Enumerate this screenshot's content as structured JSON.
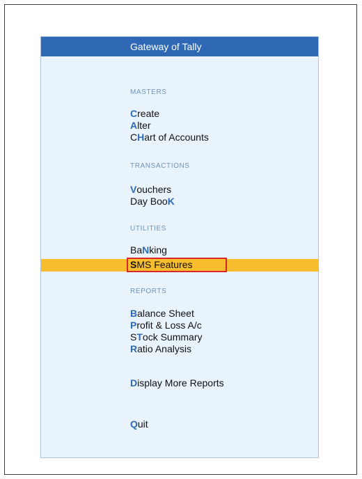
{
  "window": {
    "title": "Gateway of Tally"
  },
  "sections": {
    "masters": "MASTERS",
    "transactions": "TRANSACTIONS",
    "utilities": "UTILITIES",
    "reports": "REPORTS"
  },
  "menu": {
    "create": {
      "hotkey": "C",
      "rest": "reate"
    },
    "alter": {
      "hotkey": "A",
      "rest": "lter"
    },
    "chart": {
      "pre": "C",
      "hotkey": "H",
      "rest": "art of Accounts"
    },
    "vouchers": {
      "hotkey": "V",
      "rest": "ouchers"
    },
    "daybook": {
      "pre": "Day Boo",
      "hotkey": "K"
    },
    "banking": {
      "pre": "Ba",
      "hotkey": "N",
      "rest": "king"
    },
    "sms": {
      "hotkey": "S",
      "rest": "MS Features"
    },
    "balance": {
      "hotkey": "B",
      "rest": "alance Sheet"
    },
    "profit": {
      "hotkey": "P",
      "rest": "rofit & Loss A/c"
    },
    "stock": {
      "pre": "S",
      "hotkey": "T",
      "rest": "ock Summary"
    },
    "ratio": {
      "hotkey": "R",
      "rest": "atio Analysis"
    },
    "display_more": {
      "hotkey": "D",
      "rest": "isplay More Reports"
    },
    "quit": {
      "hotkey": "Q",
      "rest": "uit"
    }
  },
  "selected_item": "SMS Features",
  "colors": {
    "title_bar": "#2f69b5",
    "panel_bg": "#e9f3fb",
    "highlight": "#f8bd2e",
    "selection_box": "#d8262b",
    "hotkey": "#2f69b5",
    "section_label": "#6f93b9"
  }
}
